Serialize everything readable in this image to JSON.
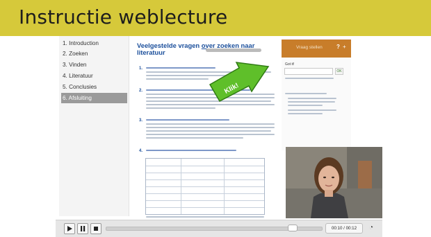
{
  "banner": {
    "title": "Instructie weblecture"
  },
  "sidebar": {
    "items": [
      {
        "label": "1. Introduction"
      },
      {
        "label": "2. Zoeken"
      },
      {
        "label": "3. Vinden"
      },
      {
        "label": "4. Literatuur"
      },
      {
        "label": "5. Conclusies"
      },
      {
        "label": "6. Afsluiting",
        "active": true
      }
    ]
  },
  "content": {
    "heading_part1": "Veelgestelde vragen",
    "heading_link": "over zoeken naar",
    "heading_part2": "literatuur",
    "question_numbers": [
      "1.",
      "2.",
      "3.",
      "4."
    ],
    "callout": "Klik!"
  },
  "right_panel": {
    "orange_label": "Vraag stellen",
    "help_icon": "?",
    "plus_icon": "+",
    "got_label": "Got it!",
    "ok_label": "OK"
  },
  "player": {
    "play_icon": "play-icon",
    "pause_icon": "pause-icon",
    "stop_icon": "stop-icon",
    "time": "00:10 / 00:12",
    "progress": 0.85
  },
  "colors": {
    "banner": "#d6c93a",
    "heading_blue": "#1b4f9b",
    "orange_header": "#c87d2a",
    "callout_green": "#5fbf2a"
  }
}
